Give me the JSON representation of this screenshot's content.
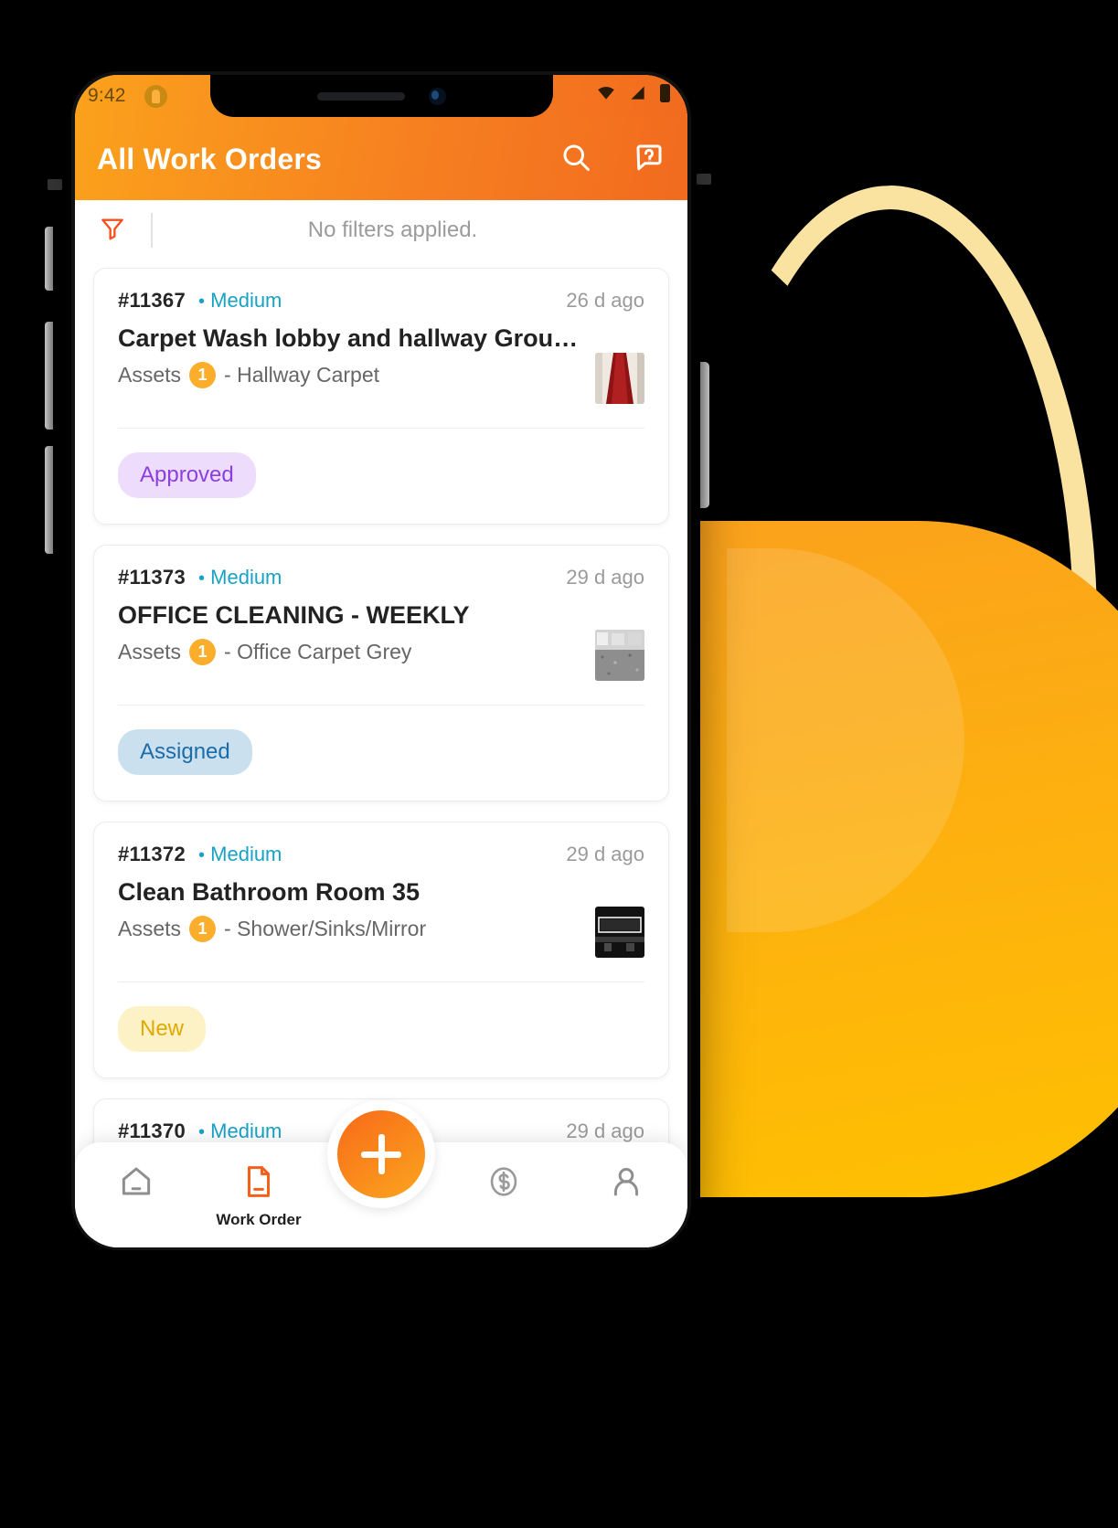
{
  "status_bar": {
    "time": "9:42",
    "app_icon": "app-badge-icon",
    "wifi_icon": "wifi-icon",
    "signal_icon": "signal-icon",
    "battery_icon": "battery-icon"
  },
  "app_bar": {
    "title": "All Work Orders",
    "search_icon": "search-icon",
    "help_icon": "help-icon",
    "gradient_from": "#FBA21C",
    "gradient_to": "#F26B1F"
  },
  "filter_bar": {
    "filter_icon": "filter-icon",
    "text": "No filters applied."
  },
  "colors": {
    "priority": "#18A2C4",
    "asset_badge": "#FBAE2B",
    "approved_bg": "#EEDCFD",
    "approved_fg": "#8B3FE0",
    "assigned_bg": "#CBE0EF",
    "assigned_fg": "#1B6CA8",
    "new_bg": "#FDF2C5",
    "new_fg": "#E0A800"
  },
  "work_orders": [
    {
      "id": "#11367",
      "priority": "Medium",
      "age": "26 d ago",
      "title": "Carpet Wash lobby and hallway Groun…",
      "assets_label": "Assets",
      "assets_count": "1",
      "asset_name": "- Hallway Carpet",
      "status": "Approved",
      "status_class": "approved",
      "thumb": "hallway-carpet-photo"
    },
    {
      "id": "#11373",
      "priority": "Medium",
      "age": "29 d ago",
      "title": "OFFICE CLEANING - WEEKLY",
      "assets_label": "Assets",
      "assets_count": "1",
      "asset_name": "- Office Carpet Grey",
      "status": "Assigned",
      "status_class": "assigned",
      "thumb": "office-carpet-photo"
    },
    {
      "id": "#11372",
      "priority": "Medium",
      "age": "29 d ago",
      "title": "Clean Bathroom Room 35",
      "assets_label": "Assets",
      "assets_count": "1",
      "asset_name": "- Shower/Sinks/Mirror",
      "status": "New",
      "status_class": "new",
      "thumb": "bathroom-mirror-photo"
    },
    {
      "id": "#11370",
      "priority": "Medium",
      "age": "29 d ago",
      "title": "",
      "assets_label": "",
      "assets_count": "",
      "asset_name": "",
      "status": "",
      "status_class": "",
      "thumb": ""
    }
  ],
  "bottom_nav": {
    "items": [
      {
        "name": "home",
        "icon": "home-icon",
        "label": "",
        "active": false
      },
      {
        "name": "work-order",
        "icon": "document-icon",
        "label": "Work Order",
        "active": true
      },
      {
        "name": "finance",
        "icon": "dollar-circle-icon",
        "label": "",
        "active": false
      },
      {
        "name": "profile",
        "icon": "person-icon",
        "label": "",
        "active": false
      }
    ],
    "fab": {
      "icon": "plus-icon",
      "label": ""
    }
  }
}
